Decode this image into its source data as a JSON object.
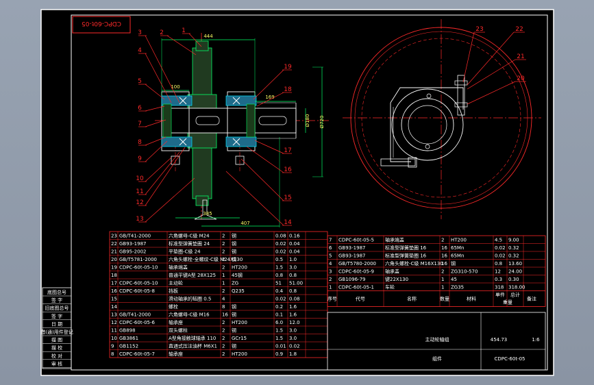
{
  "drawing": {
    "stamp_code": "CDPC-60t-05",
    "title": "主动轮轴组",
    "weight": "454.73",
    "scale": "1:6",
    "type_label": "组件",
    "drawing_no": "CDPC-60t-05"
  },
  "dimensions": {
    "d444": "444",
    "d100": "100",
    "d169": "169",
    "d180": "Ø180",
    "d720": "Ø720",
    "d385": "385",
    "d407": "407"
  },
  "callouts_left": [
    "3",
    "2",
    "1",
    "4",
    "5",
    "6",
    "7",
    "8",
    "9",
    "10",
    "11",
    "12",
    "13"
  ],
  "callouts_right": [
    "19",
    "18",
    "17",
    "16",
    "15",
    "14"
  ],
  "callouts_side": [
    "23",
    "22",
    "21",
    "20"
  ],
  "left_strip": [
    "底图总号",
    "签 字",
    "旧底图总号",
    "签 字",
    "日 期",
    "借(通)用件登记",
    "描 图",
    "描 校",
    "校 对",
    "审 核"
  ],
  "bom_left": [
    [
      "23",
      "GB/T41-2000",
      "六角螺母-C级 M24",
      "2",
      "钢",
      "0.08",
      "0.16",
      ""
    ],
    [
      "22",
      "GB93-1987",
      "标准型弹簧垫圈 24",
      "2",
      "钢",
      "0.02",
      "0.04",
      ""
    ],
    [
      "21",
      "GB95-2002",
      "平垫圈-C级 24",
      "2",
      "钢",
      "0.02",
      "0.04",
      ""
    ],
    [
      "20",
      "GB/T5781-2000",
      "六角头螺栓-全螺纹-C级 M24X130",
      "2",
      "钢",
      "0.5",
      "1.0",
      ""
    ],
    [
      "19",
      "CDPC-60t-05-10",
      "轴承端盖",
      "2",
      "HT200",
      "1.5",
      "3.0",
      ""
    ],
    [
      "18",
      "",
      "普通平键A型 28X125",
      "1",
      "45钢",
      "0.8",
      "0.8",
      ""
    ],
    [
      "17",
      "CDPC-60t-05-10",
      "主动轮",
      "1",
      "ZG",
      "51",
      "51.00",
      ""
    ],
    [
      "16",
      "CDPC-60t-05-8",
      "挡板",
      "2",
      "Q235",
      "0.4",
      "0.8",
      ""
    ],
    [
      "15",
      "",
      "滑动轴承的毡圈 0.5",
      "4",
      "",
      "0.02",
      "0.08",
      ""
    ],
    [
      "14",
      "",
      "螺栓",
      "8",
      "钢",
      "0.2",
      "1.6",
      ""
    ],
    [
      "13",
      "GB/T41-2000",
      "六角螺母-C级 M16",
      "16",
      "钢",
      "0.1",
      "1.6",
      ""
    ],
    [
      "12",
      "CDPC-60t-05-6",
      "轴承座",
      "2",
      "HT200",
      "6.0",
      "12.0",
      ""
    ],
    [
      "11",
      "GB898",
      "双头螺柱",
      "2",
      "钢",
      "1.5",
      "3.0",
      ""
    ],
    [
      "10",
      "GB3861",
      "A型角接触球轴承 110",
      "2",
      "GCr15",
      "1.5",
      "3.0",
      ""
    ],
    [
      "9",
      "GB1152",
      "直通式压注油杯 M6X1",
      "2",
      "钢",
      "0.01",
      "0.02",
      ""
    ],
    [
      "8",
      "CDPC-60t-05-7",
      "轴承座",
      "2",
      "HT200",
      "0.9",
      "1.8",
      ""
    ]
  ],
  "bom_right": [
    [
      "7",
      "CDPC-60t-05-5",
      "轴承端盖",
      "2",
      "HT200",
      "4.5",
      "9.00"
    ],
    [
      "6",
      "GB93-1987",
      "标准型弹簧垫圈 16",
      "16",
      "65Mn",
      "0.02",
      "0.32"
    ],
    [
      "5",
      "GB93-1987",
      "标准型弹簧垫圈 16",
      "16",
      "65Mn",
      "0.02",
      "0.32"
    ],
    [
      "4",
      "GB/T5780-2000",
      "六角头螺栓-C级 M16X130",
      "16",
      "钢",
      "0.8",
      "13.60"
    ],
    [
      "3",
      "CDPC-60t-05-9",
      "轴承盖",
      "2",
      "ZG310-570",
      "12",
      "24.00"
    ],
    [
      "2",
      "GB1096-79",
      "键22X130",
      "1",
      "45",
      "0.3",
      "0.30"
    ],
    [
      "1",
      "CDPC-60t-05-1",
      "车轮",
      "1",
      "ZG35",
      "318",
      "318.00"
    ]
  ],
  "bom_header": {
    "seq": "序号",
    "code": "代号",
    "name": "名称",
    "qty": "数量",
    "material": "材料",
    "single": "单件",
    "total": "总计",
    "weight": "重量",
    "remark": "备注"
  }
}
